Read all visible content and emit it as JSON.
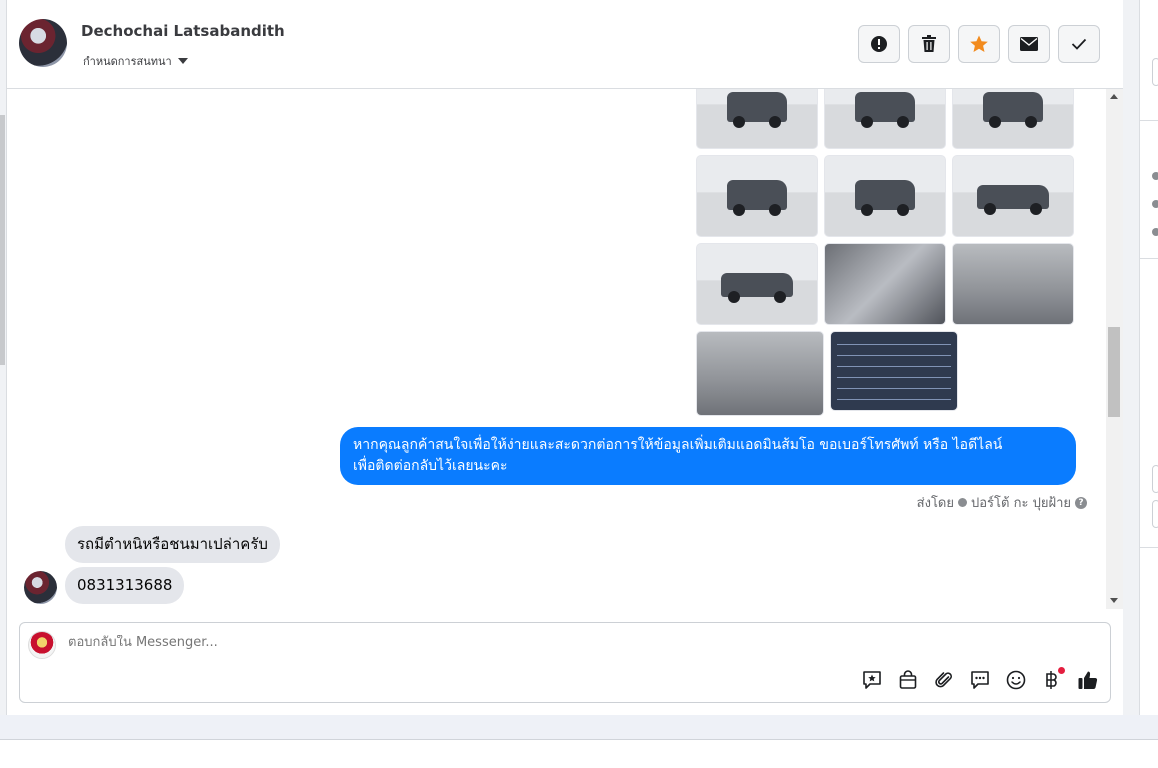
{
  "header": {
    "contact_name": "Dechochai Latsabandith",
    "assign_label": "กำหนดการสนทนา"
  },
  "actions": [
    {
      "name": "spam-button",
      "icon": "alert-icon"
    },
    {
      "name": "delete-button",
      "icon": "trash-icon"
    },
    {
      "name": "star-button",
      "icon": "star-icon",
      "color": "#f28b1e"
    },
    {
      "name": "mark-unread-button",
      "icon": "envelope-icon"
    },
    {
      "name": "done-button",
      "icon": "check-icon"
    }
  ],
  "messages": {
    "outgoing_text_line1": "หากคุณลูกค้าสนใจเพื่อให้ง่ายและสะดวกต่อการให้ข้อมูลเพิ่มเติมแอดมินส้มโอ ขอเบอร์โทรศัพท์ หรือ ไอดีไลน์",
    "outgoing_text_line2": "เพื่อติดต่อกลับไว้เลยนะคะ",
    "sent_by_prefix": "ส่งโดย",
    "sent_by_name": "ปอร์โต้ กะ ปุยฝ้าย",
    "incoming_1": "รถมีตำหนิหรือชนมาเปล่าครับ",
    "incoming_2": "0831313688"
  },
  "composer": {
    "placeholder": "ตอบกลับใน Messenger..."
  },
  "colors": {
    "outgoing_bubble": "#0a7cff",
    "incoming_bubble": "#e4e6eb",
    "star": "#f28b1e"
  }
}
